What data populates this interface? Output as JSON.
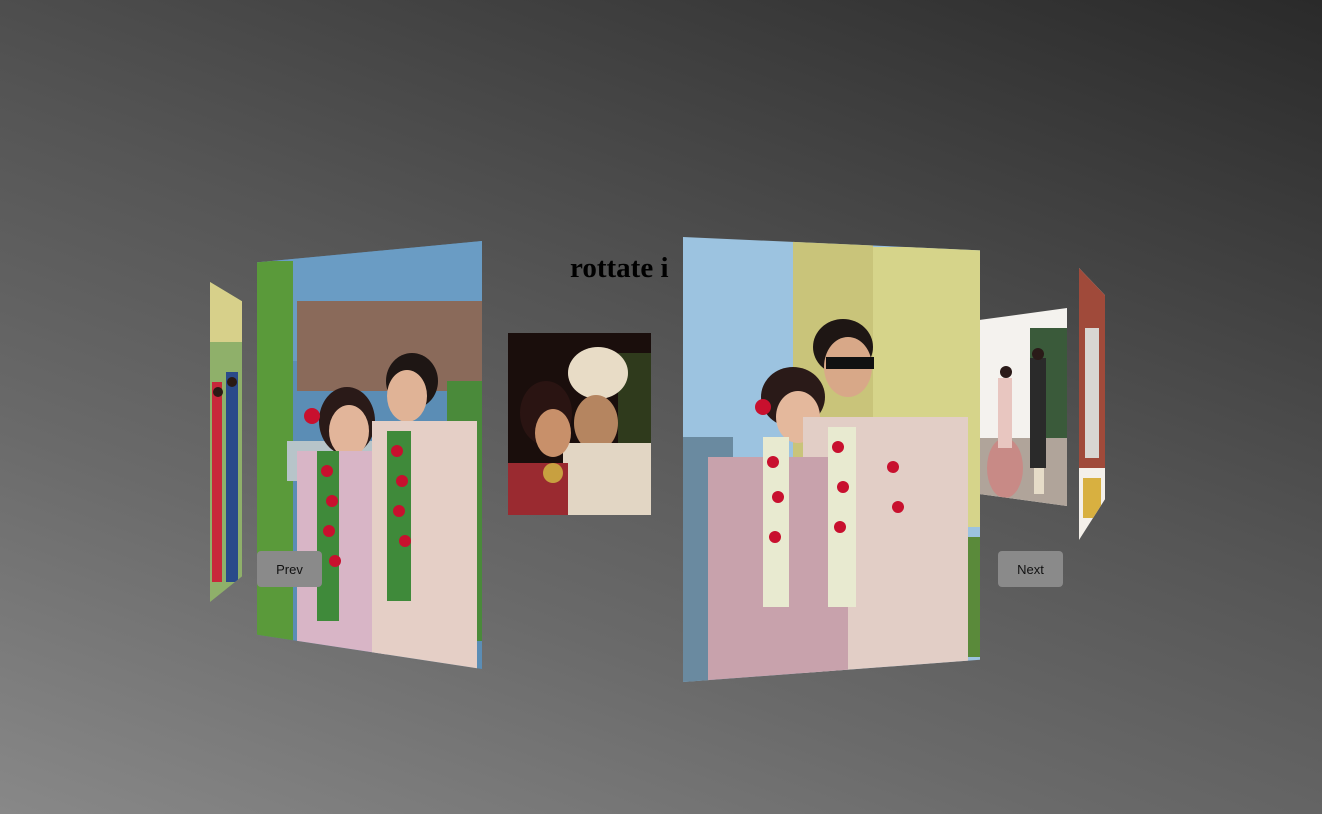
{
  "title": "rottate i",
  "controls": {
    "prev_label": "Prev",
    "next_label": "Next"
  },
  "colors": {
    "background_dark": "#2a2a2a",
    "background_light": "#888888",
    "button": "#8a8a8a"
  }
}
